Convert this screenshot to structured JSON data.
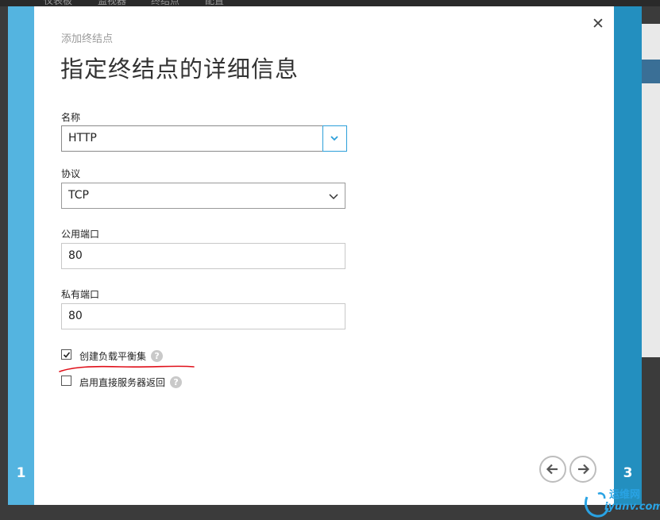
{
  "background": {
    "tabs": [
      "仪表板",
      "监视器",
      "终结点",
      "配置"
    ]
  },
  "dialog": {
    "subtitle": "添加终结点",
    "title": "指定终结点的详细信息",
    "close_icon": "close-icon",
    "step_left": "1",
    "step_right": "3"
  },
  "form": {
    "name": {
      "label": "名称",
      "value": "HTTP"
    },
    "protocol": {
      "label": "协议",
      "value": "TCP"
    },
    "public_port": {
      "label": "公用端口",
      "value": "80"
    },
    "private_port": {
      "label": "私有端口",
      "value": "80"
    },
    "load_balanced": {
      "label": "创建负载平衡集",
      "checked": true,
      "help": "?"
    },
    "direct_server_return": {
      "label": "启用直接服务器返回",
      "checked": false,
      "help": "?"
    }
  },
  "nav": {
    "back_icon": "arrow-left-icon",
    "next_icon": "arrow-right-icon"
  },
  "watermark": {
    "line1": "运维网",
    "line2": "iyunv.com"
  },
  "colors": {
    "left_rail": "#54b4e0",
    "right_rail": "#238fbf",
    "accent": "#2d9fd9",
    "annotation": "#e0101a"
  }
}
